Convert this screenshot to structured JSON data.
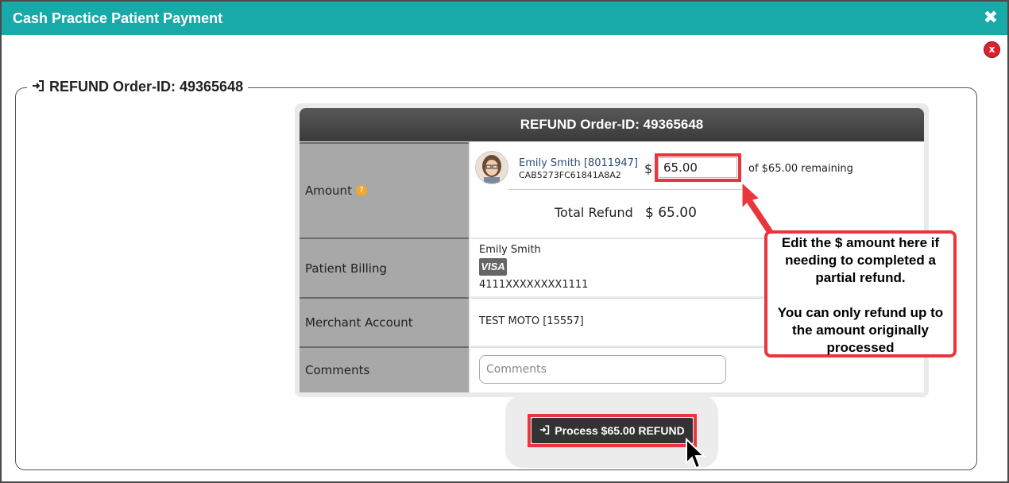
{
  "window": {
    "title": "Cash Practice Patient Payment",
    "close_glyph": "✖",
    "close_red_glyph": "x"
  },
  "legend": {
    "title": "REFUND Order-ID: 49365648",
    "icon": "sign-in-icon"
  },
  "panel": {
    "header": "REFUND Order-ID: 49365648",
    "rows": {
      "amount_label": "Amount",
      "billing_label": "Patient Billing",
      "merchant_label": "Merchant Account",
      "comments_label": "Comments"
    },
    "amount": {
      "patient_name": "Emily Smith [8011947]",
      "hash": "CAB5273FC61841A8A2",
      "dollar": "$",
      "value": "65.00",
      "remaining": "of  $65.00 remaining",
      "total_label": "Total Refund",
      "total_value": "$ 65.00"
    },
    "billing": {
      "name": "Emily Smith",
      "card_brand": "VISA",
      "card_number": "4111XXXXXXXX1111"
    },
    "merchant": "TEST MOTO [15557]",
    "comments_placeholder": "Comments"
  },
  "button": {
    "label": "Process $65.00 REFUND",
    "icon": "sign-in-icon"
  },
  "callout": {
    "line1": "Edit the $ amount here if needing to completed a partial refund.",
    "line2": "You can only refund up to the amount originally processed"
  },
  "colors": {
    "teal": "#17aaa8",
    "highlight": "#e8363c",
    "header": "#444444"
  }
}
